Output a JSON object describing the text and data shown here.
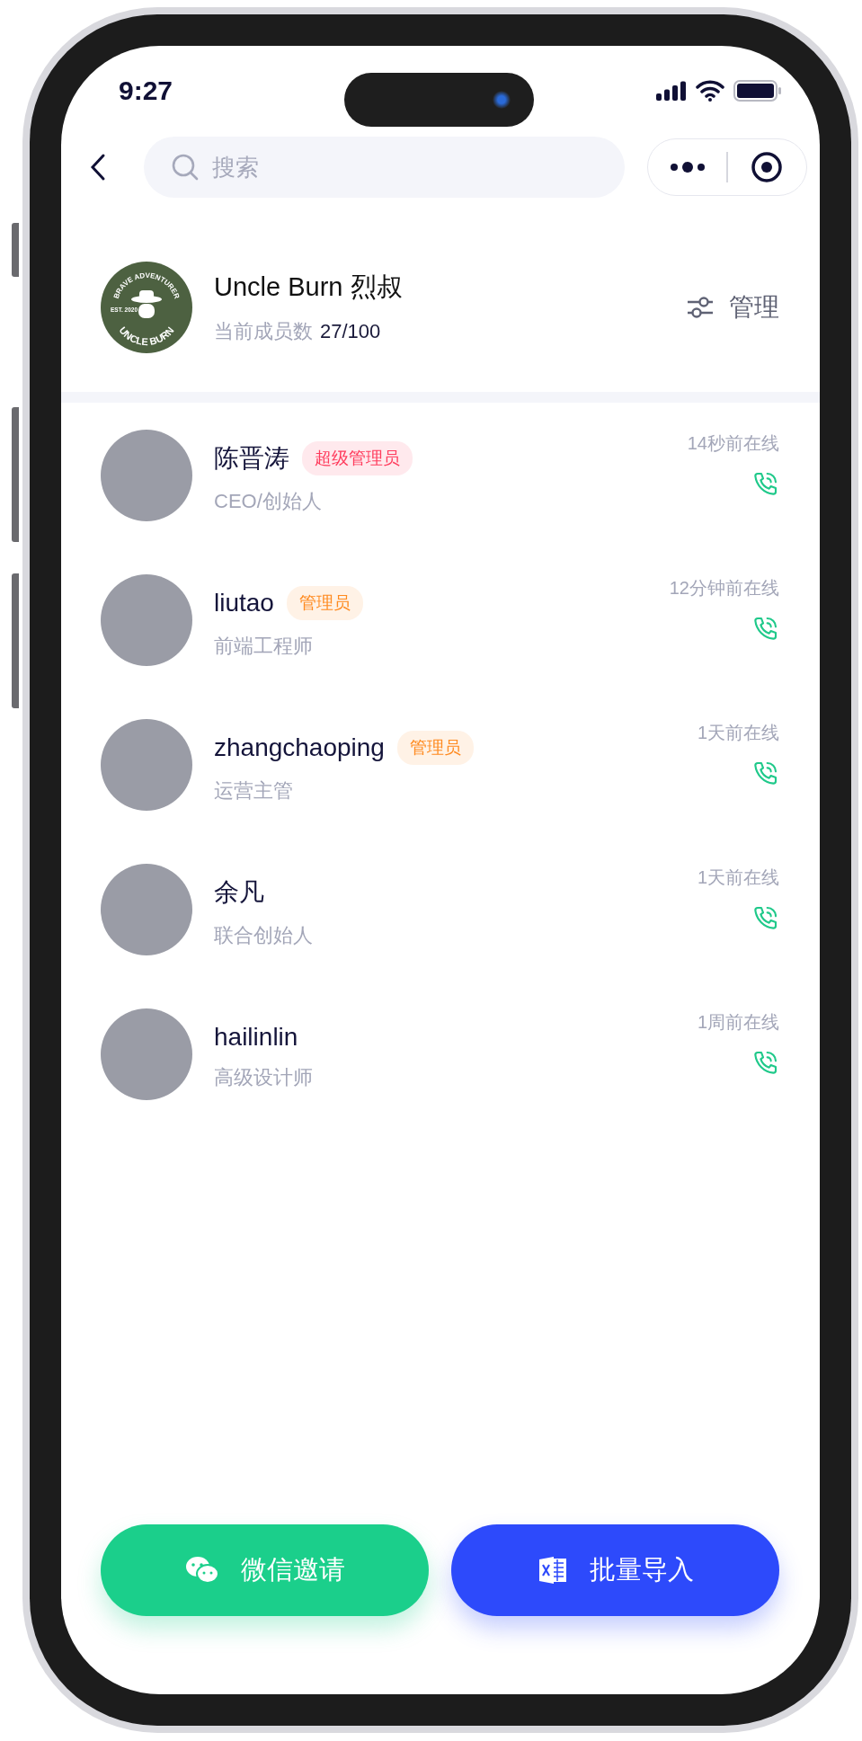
{
  "status_bar": {
    "time": "9:27"
  },
  "search": {
    "placeholder": "搜索"
  },
  "group": {
    "logo": {
      "top": "BRAVE ADVENTURER",
      "bottom": "UNCLE BURN",
      "est": "EST. 2020"
    },
    "name": "Uncle Burn 烈叔",
    "count_label": "当前成员数",
    "count": "27/100",
    "manage": "管理"
  },
  "members": [
    {
      "name": "陈晋涛",
      "badge": {
        "label": "超级管理员",
        "color": "#ff3b5c"
      },
      "title": "CEO/创始人",
      "last_seen": "14秒前在线"
    },
    {
      "name": "liutao",
      "badge": {
        "label": "管理员",
        "color": "#ff8a1f"
      },
      "title": "前端工程师",
      "last_seen": "12分钟前在线"
    },
    {
      "name": "zhangchaoping",
      "badge": {
        "label": "管理员",
        "color": "#ff8a1f"
      },
      "title": "运营主管",
      "last_seen": "1天前在线"
    },
    {
      "name": "余凡",
      "title": "联合创始人",
      "last_seen": "1天前在线"
    },
    {
      "name": "hailinlin",
      "title": "高级设计师",
      "last_seen": "1周前在线"
    }
  ],
  "actions": [
    {
      "kind": "wechat",
      "label": "微信邀请"
    },
    {
      "kind": "excel",
      "label": "批量导入"
    }
  ]
}
